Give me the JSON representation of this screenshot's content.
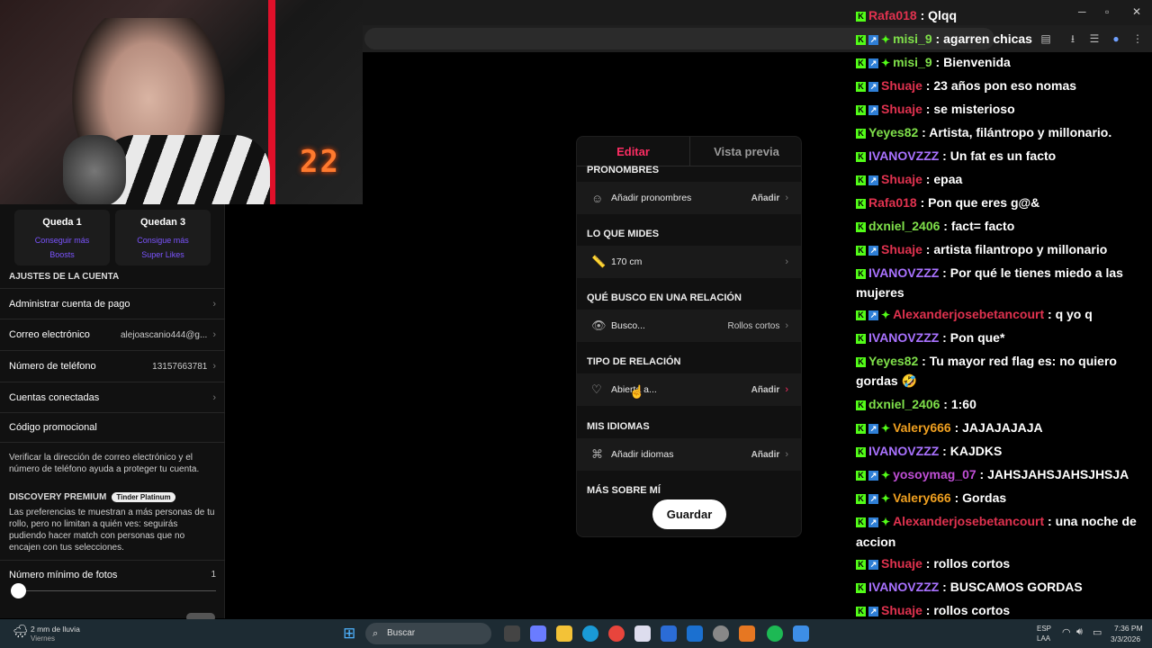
{
  "modal": {
    "tab_edit": "Editar",
    "tab_preview": "Vista previa",
    "sections": [
      {
        "title": "PRONOMBRES",
        "label": "Añadir pronombres",
        "action": "Añadir"
      },
      {
        "title": "LO QUE MIDES",
        "label": "170 cm",
        "action": ""
      },
      {
        "title": "QUÉ BUSCO EN UNA RELACIÓN",
        "label": "Busco...",
        "action": "Rollos cortos"
      },
      {
        "title": "TIPO DE RELACIÓN",
        "label": "Abierta a...",
        "action": "Añadir"
      },
      {
        "title": "MIS IDIOMAS",
        "label": "Añadir idiomas",
        "action": "Añadir"
      },
      {
        "title": "MÁS SOBRE MÍ",
        "label": "",
        "action": ""
      }
    ],
    "save_label": "Guardar"
  },
  "sidebar": {
    "cards": [
      {
        "title": "Queda 1",
        "line1": "Conseguir más",
        "line2": "Boosts"
      },
      {
        "title": "Quedan 3",
        "line1": "Consigue más",
        "line2": "Super Likes"
      }
    ],
    "account_title": "AJUSTES DE LA CUENTA",
    "rows": [
      {
        "label": "Administrar cuenta de pago",
        "value": ""
      },
      {
        "label": "Correo electrónico",
        "value": "alejoascanio444@g..."
      },
      {
        "label": "Número de teléfono",
        "value": "13157663781"
      },
      {
        "label": "Cuentas conectadas",
        "value": ""
      },
      {
        "label": "Código promocional",
        "value": ""
      }
    ],
    "verify_text": "Verificar la dirección de correo electrónico y el número de teléfono ayuda a proteger tu cuenta.",
    "discovery_title": "DISCOVERY PREMIUM",
    "discovery_badge": "Tinder Platinum",
    "discovery_text": "Las preferencias te muestran a más personas de tu rollo, pero no limitan a quién ves: seguirás pudiendo hacer match con personas que no encajen con tus selecciones.",
    "min_photos_label": "Número mínimo de fotos",
    "min_photos_value": "1"
  },
  "webcam": {
    "overlay_number": "22"
  },
  "chat": [
    {
      "user": "Rafa018",
      "color": "#e0324f",
      "badges": [
        "k"
      ],
      "text": "Qlqq"
    },
    {
      "user": "misi_9",
      "color": "#7fe04a",
      "badges": [
        "k",
        "b",
        "g"
      ],
      "text": "agarren chicas"
    },
    {
      "user": "misi_9",
      "color": "#7fe04a",
      "badges": [
        "k",
        "b",
        "g"
      ],
      "text": "Bienvenida"
    },
    {
      "user": "Shuaje",
      "color": "#e0324f",
      "badges": [
        "k",
        "b"
      ],
      "text": "23 años pon eso nomas"
    },
    {
      "user": "Shuaje",
      "color": "#e0324f",
      "badges": [
        "k",
        "b"
      ],
      "text": "se misterioso"
    },
    {
      "user": "Yeyes82",
      "color": "#7fe04a",
      "badges": [
        "k"
      ],
      "text": "Artista, filántropo y millonario."
    },
    {
      "user": "IVANOVZZZ",
      "color": "#a972ff",
      "badges": [
        "k"
      ],
      "text": "Un fat es un facto"
    },
    {
      "user": "Shuaje",
      "color": "#e0324f",
      "badges": [
        "k",
        "b"
      ],
      "text": "epaa"
    },
    {
      "user": "Rafa018",
      "color": "#e0324f",
      "badges": [
        "k"
      ],
      "text": "Pon que eres g@&"
    },
    {
      "user": "dxniel_2406",
      "color": "#7fe04a",
      "badges": [
        "k"
      ],
      "text": "fact= facto"
    },
    {
      "user": "Shuaje",
      "color": "#e0324f",
      "badges": [
        "k",
        "b"
      ],
      "text": "artista filantropo y millonario"
    },
    {
      "user": "IVANOVZZZ",
      "color": "#a972ff",
      "badges": [
        "k"
      ],
      "text": "Por qué le tienes miedo a las mujeres"
    },
    {
      "user": "Alexanderjosebetancourt",
      "color": "#e0324f",
      "badges": [
        "k",
        "b",
        "g"
      ],
      "text": "q yo q"
    },
    {
      "user": "IVANOVZZZ",
      "color": "#a972ff",
      "badges": [
        "k"
      ],
      "text": "Pon que*"
    },
    {
      "user": "Yeyes82",
      "color": "#7fe04a",
      "badges": [
        "k"
      ],
      "text": "Tu mayor red flag es: no quiero gordas 🤣"
    },
    {
      "user": "dxniel_2406",
      "color": "#7fe04a",
      "badges": [
        "k"
      ],
      "text": "1:60"
    },
    {
      "user": "Valery666",
      "color": "#f0a020",
      "badges": [
        "k",
        "b",
        "g"
      ],
      "text": "JAJAJAJAJA"
    },
    {
      "user": "IVANOVZZZ",
      "color": "#a972ff",
      "badges": [
        "k"
      ],
      "text": "KAJDKS"
    },
    {
      "user": "yosoymag_07",
      "color": "#c04fd6",
      "badges": [
        "k",
        "b",
        "g"
      ],
      "text": "JAHSJAHSJAHSJHSJA"
    },
    {
      "user": "Valery666",
      "color": "#f0a020",
      "badges": [
        "k",
        "b",
        "g"
      ],
      "text": "Gordas"
    },
    {
      "user": "Alexanderjosebetancourt",
      "color": "#e0324f",
      "badges": [
        "k",
        "b",
        "g"
      ],
      "text": "una noche de accion"
    },
    {
      "user": "Shuaje",
      "color": "#e0324f",
      "badges": [
        "k",
        "b"
      ],
      "text": "rollos cortos"
    },
    {
      "user": "IVANOVZZZ",
      "color": "#a972ff",
      "badges": [
        "k"
      ],
      "text": "BUSCAMOS GORDAS"
    },
    {
      "user": "Shuaje",
      "color": "#e0324f",
      "badges": [
        "k",
        "b"
      ],
      "text": "rollos cortos"
    },
    {
      "user": "Shuaje",
      "color": "#e0324f",
      "badges": [
        "k",
        "b"
      ],
      "text": "rollos cortos"
    }
  ],
  "taskbar": {
    "weather": "2 mm de lluvia",
    "weather_day": "Viernes",
    "search_placeholder": "Buscar",
    "lang": "ESP",
    "lang2": "LAA",
    "time": "7:36 PM",
    "date": "3/3/2026"
  }
}
